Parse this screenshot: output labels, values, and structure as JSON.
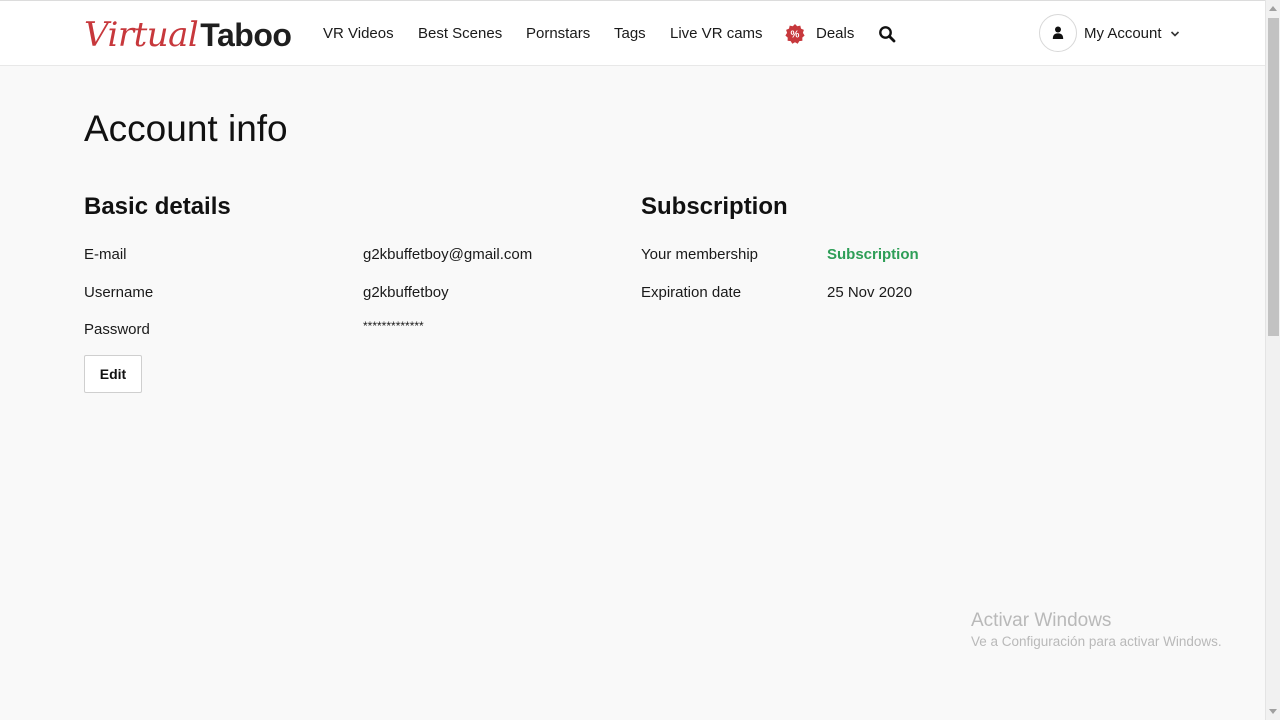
{
  "header": {
    "logo": {
      "part1": "Virtual",
      "part2": "Taboo"
    },
    "nav": [
      {
        "label": "VR Videos"
      },
      {
        "label": "Best Scenes"
      },
      {
        "label": "Pornstars"
      },
      {
        "label": "Tags"
      },
      {
        "label": "Live VR cams"
      },
      {
        "label": "Deals",
        "badge": "%"
      }
    ],
    "account_label": "My Account",
    "icons": {
      "search": "search-icon",
      "account": "user-icon",
      "dropdown": "chevron-down-icon",
      "deals": "percent-badge-icon"
    }
  },
  "page": {
    "title": "Account info",
    "basic_details": {
      "heading": "Basic details",
      "rows": [
        {
          "label": "E-mail",
          "value": "g2kbuffetboy@gmail.com"
        },
        {
          "label": "Username",
          "value": "g2kbuffetboy"
        },
        {
          "label": "Password",
          "value": "*************"
        }
      ],
      "edit_label": "Edit"
    },
    "subscription": {
      "heading": "Subscription",
      "rows": [
        {
          "label": "Your membership",
          "value": "Subscription"
        },
        {
          "label": "Expiration date",
          "value": "25 Nov 2020"
        }
      ]
    }
  },
  "watermark": {
    "title": "Activar Windows",
    "subtitle": "Ve a Configuración para activar Windows."
  },
  "colors": {
    "brand_red": "#c7383c",
    "membership_green": "#2e9e57",
    "background": "#f9f9f9"
  }
}
